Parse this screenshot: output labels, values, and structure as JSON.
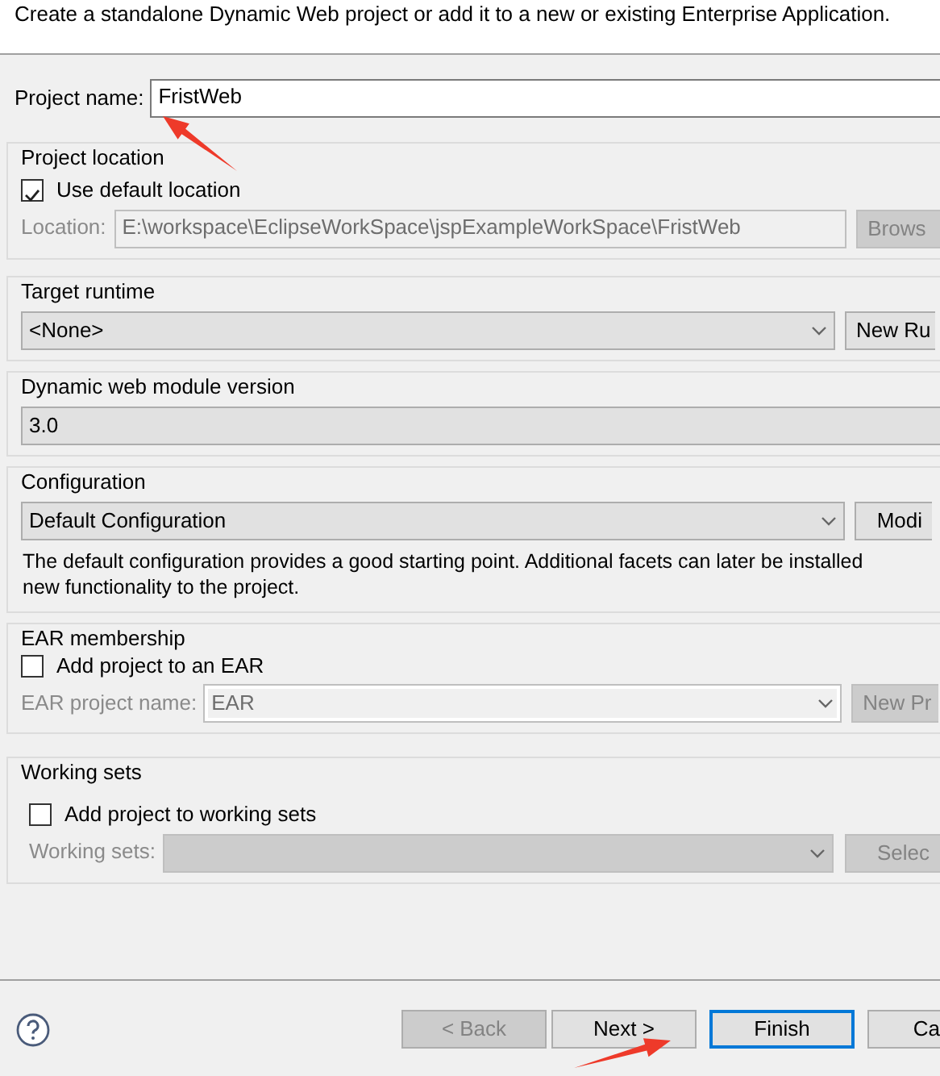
{
  "header": {
    "description": "Create a standalone Dynamic Web project or add it to a new or existing Enterprise Application."
  },
  "project_name": {
    "label": "Project name:",
    "value": "FristWeb"
  },
  "project_location": {
    "title": "Project location",
    "use_default": {
      "label": "Use default location",
      "checked": true
    },
    "location": {
      "label": "Location:",
      "value": "E:\\workspace\\EclipseWorkSpace\\jspExampleWorkSpace\\FristWeb",
      "disabled": true
    },
    "button": {
      "label": "Brows",
      "disabled": true
    }
  },
  "target_runtime": {
    "title": "Target runtime",
    "selection": "<None>",
    "button": {
      "label": "New Ru",
      "disabled": false
    }
  },
  "module_version": {
    "title": "Dynamic web module version",
    "selection": "3.0"
  },
  "configuration": {
    "title": "Configuration",
    "selection": "Default Configuration",
    "button": {
      "label": "Modi",
      "disabled": false
    },
    "description": "The default configuration provides a good starting point. Additional facets can later be installed\nnew functionality to the project."
  },
  "ear_membership": {
    "title": "EAR membership",
    "add_to_ear": {
      "label": "Add project to an EAR",
      "checked": false
    },
    "ear_project": {
      "label": "EAR project name:",
      "value": "EAR",
      "disabled": true
    },
    "button": {
      "label": "New Pr",
      "disabled": true
    }
  },
  "working_sets": {
    "title": "Working sets",
    "add_to_sets": {
      "label": "Add project to working sets",
      "checked": false
    },
    "sets": {
      "label": "Working sets:",
      "disabled": true
    },
    "button": {
      "label": "Selec",
      "disabled": true
    }
  },
  "buttons": [
    {
      "label": "< Back",
      "disabled": true,
      "default": false
    },
    {
      "label": "Next >",
      "disabled": false,
      "default": false
    },
    {
      "label": "Finish",
      "disabled": false,
      "default": true
    },
    {
      "label": "Ca",
      "disabled": false,
      "default": false
    }
  ]
}
